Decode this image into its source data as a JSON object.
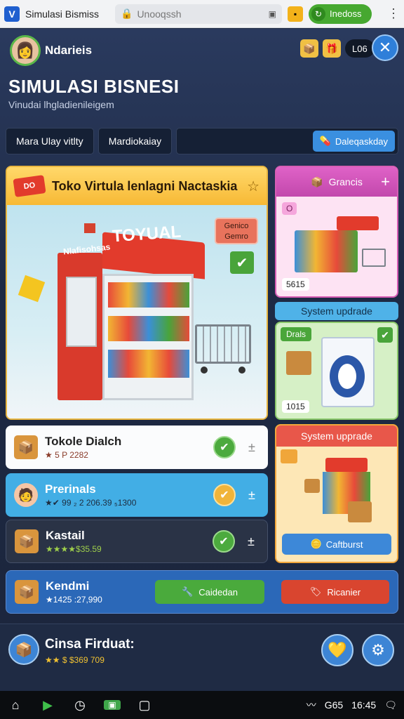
{
  "browser": {
    "tab_title": "Simulasi Bismiss",
    "address_placeholder": "Unooqssh",
    "action_button": "Inedoss"
  },
  "header": {
    "username": "Ndarieis",
    "counter": "L06",
    "title": "SIMULASI BISNESI",
    "subtitle": "Vinudai lhgladienileigem"
  },
  "tabs": {
    "tab1": "Mara Ulay vitlty",
    "tab2": "Mardiokaiay",
    "action": "Daleqaskday"
  },
  "store_card": {
    "badge": "DO",
    "title": "Toko Virtula lenlagni Nactaskia",
    "sign": "TOYUAL",
    "side_text": "Nlafisohsas",
    "tag_line1": "Genico",
    "tag_line2": "Gemro"
  },
  "right_cards": {
    "card1_title": "Grancis",
    "card1_badge": "O",
    "card1_value": "5615",
    "pill": "System updrade",
    "card2_label": "Drals",
    "card2_value": "1015",
    "card3_title": "System upprade",
    "card3_button": "Caftburst"
  },
  "rows": [
    {
      "name": "Tokole Dialch",
      "meta": "★ 5 P  2282"
    },
    {
      "name": "Prerinals",
      "meta": "★✔ 99  ₂ 2 206.39  ₅1300"
    },
    {
      "name": "Kastail",
      "meta": "★★★★$35.59"
    },
    {
      "name": "Kendmi",
      "meta": "★1425  :27,990",
      "button_green": "Caidedan",
      "button_red": "Ricanier"
    }
  ],
  "footer": {
    "title": "Cinsa Firduat:",
    "meta": "★★ $ $369 709"
  },
  "taskbar": {
    "status": "G65",
    "time": "16:45"
  }
}
